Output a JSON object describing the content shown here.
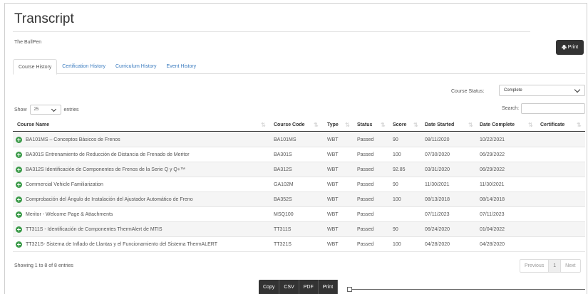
{
  "page": {
    "title": "Transcript",
    "subtitle": "The BullPen",
    "print_label": "Print"
  },
  "tabs": [
    {
      "label": "Course History",
      "active": true
    },
    {
      "label": "Certification History"
    },
    {
      "label": "Curriculum History"
    },
    {
      "label": "Event History"
    }
  ],
  "filters": {
    "course_status_label": "Course Status:",
    "course_status_value": "Complete",
    "show_label": "Show",
    "show_value": "25",
    "entries_label": "entries",
    "search_label": "Search:",
    "search_value": ""
  },
  "table": {
    "columns": [
      "Course Name",
      "Course Code",
      "Type",
      "Status",
      "Score",
      "Date Started",
      "Date Complete",
      "Certificate"
    ],
    "rows": [
      [
        "BA101MS – Conceptos Básicos de Frenos",
        "BA101MS",
        "WBT",
        "Passed",
        "90",
        "08/11/2020",
        "10/22/2021",
        ""
      ],
      [
        "BA301S Entrenamiento de Reducción de Distancia de Frenado de Meritor",
        "BA301S",
        "WBT",
        "Passed",
        "100",
        "07/30/2020",
        "06/29/2022",
        ""
      ],
      [
        "BA312S Identificación de Componentes de Frenos de la Serie Q y Q+™",
        "BA312S",
        "WBT",
        "Passed",
        "92.85",
        "03/31/2020",
        "06/29/2022",
        ""
      ],
      [
        "Commercial Vehicle Familiarization",
        "GA102M",
        "WBT",
        "Passed",
        "90",
        "11/30/2021",
        "11/30/2021",
        ""
      ],
      [
        "Comprobación del Ángulo de Instalación del Ajustador Automático de Freno",
        "BA352S",
        "WBT",
        "Passed",
        "100",
        "08/13/2018",
        "08/14/2018",
        ""
      ],
      [
        "Meritor - Welcome Page & Attachments",
        "MSQ100",
        "WBT",
        "Passed",
        "",
        "07/11/2023",
        "07/11/2023",
        ""
      ],
      [
        "TT311S - Identificación de Componentes ThermAlert de MTIS",
        "TT311S",
        "WBT",
        "Passed",
        "90",
        "06/24/2020",
        "01/04/2022",
        ""
      ],
      [
        "TT321S- Sistema de Inflado de Llantas y el Funcionamiento del Sistema ThermALERT",
        "TT321S",
        "WBT",
        "Passed",
        "100",
        "04/28/2020",
        "04/28/2020",
        ""
      ]
    ]
  },
  "footer": {
    "info": "Showing 1 to 8 of 8 entries",
    "pagination": [
      "Previous",
      "1",
      "Next"
    ],
    "export_buttons": [
      "Copy",
      "CSV",
      "PDF",
      "Print"
    ]
  },
  "colors": {
    "accent": "#3a7bbf",
    "dark_button": "#333333",
    "expand_icon": "#3c9b4a"
  }
}
